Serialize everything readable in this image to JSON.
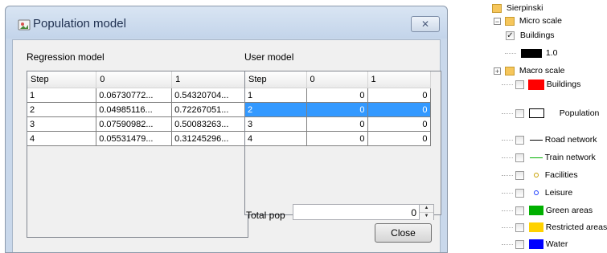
{
  "dialog": {
    "title": "Population model",
    "regression_label": "Regression model",
    "user_label": "User model",
    "regression_table": {
      "columns": [
        "Step",
        "0",
        "1"
      ],
      "rows": [
        [
          "1",
          "0.06730772...",
          "0.54320704..."
        ],
        [
          "2",
          "0.04985116...",
          "0.72267051..."
        ],
        [
          "3",
          "0.07590982...",
          "0.50083263..."
        ],
        [
          "4",
          "0.05531479...",
          "0.31245296..."
        ]
      ]
    },
    "user_table": {
      "columns": [
        "Step",
        "0",
        "1"
      ],
      "rows": [
        [
          "1",
          "0",
          "0"
        ],
        [
          "2",
          "0",
          "0"
        ],
        [
          "3",
          "0",
          "0"
        ],
        [
          "4",
          "0",
          "0"
        ]
      ],
      "selected_row": 2
    },
    "total_pop_label": "Total pop",
    "total_pop_value": "0",
    "close_label": "Close",
    "close_glyph": "✕"
  },
  "tree": {
    "root": "Sierpinski",
    "micro_scale": "Micro scale",
    "buildings_micro": "Buildings",
    "buildings_micro_value": "1.0",
    "macro_scale": "Macro scale",
    "buildings_macro": "Buildings",
    "population": "Population",
    "road_network": "Road network",
    "train_network": "Train network",
    "facilities": "Facilities",
    "leisure": "Leisure",
    "green_areas": "Green areas",
    "restricted_areas": "Restricted areas",
    "water": "Water",
    "colors": {
      "buildings_micro": "#000000",
      "buildings_macro": "#ff0000",
      "road_network": "#000000",
      "train_network": "#00b000",
      "facilities": "#c8a000",
      "leisure": "#1a3cff",
      "green_areas": "#00b000",
      "restricted_areas": "#ffd200",
      "water": "#0000ff"
    }
  }
}
